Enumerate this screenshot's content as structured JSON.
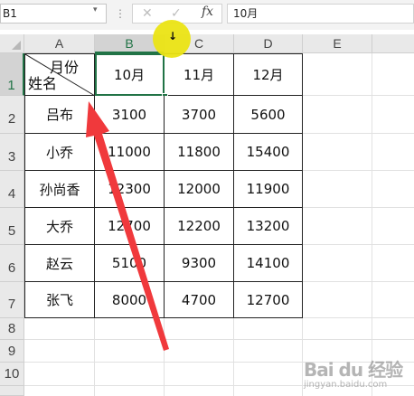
{
  "formula_bar": {
    "name_box": "B1",
    "cancel_icon": "✕",
    "confirm_icon": "✓",
    "fx_label": "fx",
    "formula_value": "10月"
  },
  "columns": [
    "A",
    "B",
    "C",
    "D",
    "E"
  ],
  "rows": [
    "1",
    "2",
    "3",
    "4",
    "5",
    "6",
    "7",
    "8",
    "9",
    "10"
  ],
  "header": {
    "diag_top": "月份",
    "diag_bottom": "姓名",
    "months": [
      "10月",
      "11月",
      "12月"
    ]
  },
  "table": [
    {
      "name": "吕布",
      "v": [
        "3100",
        "3700",
        "5600"
      ]
    },
    {
      "name": "小乔",
      "v": [
        "11000",
        "11800",
        "15400"
      ]
    },
    {
      "name": "孙尚香",
      "v": [
        "12300",
        "12000",
        "11900"
      ]
    },
    {
      "name": "大乔",
      "v": [
        "12700",
        "12200",
        "13200"
      ]
    },
    {
      "name": "赵云",
      "v": [
        "5100",
        "9300",
        "14100"
      ]
    },
    {
      "name": "张飞",
      "v": [
        "8000",
        "4700",
        "12700"
      ]
    }
  ],
  "selection": {
    "cell": "B1",
    "accent": "#217346"
  },
  "watermark": {
    "line1": "Bai du 经验",
    "line2": "jingyan.baidu.com"
  },
  "annotation": {
    "arrow_color": "#f0393c",
    "cursor_color": "#ebe414"
  }
}
